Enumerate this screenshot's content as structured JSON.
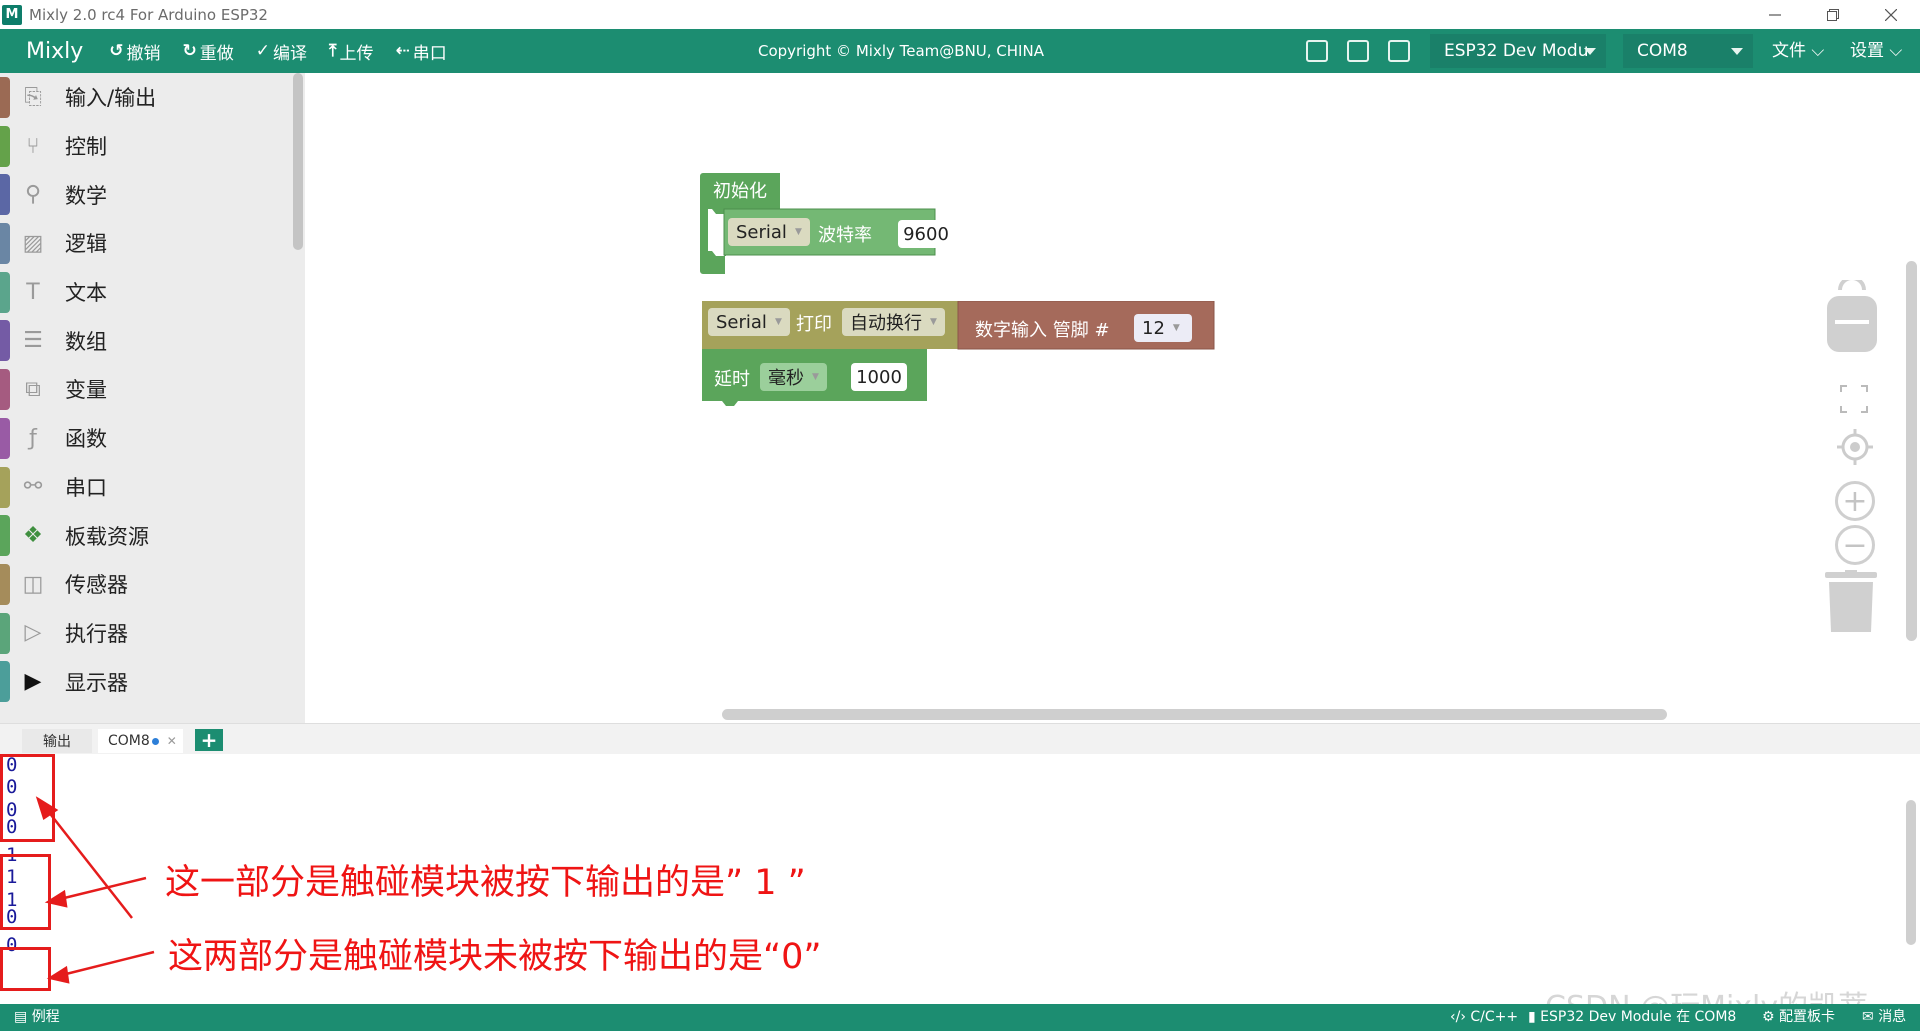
{
  "window": {
    "title": "Mixly 2.0 rc4 For Arduino ESP32",
    "icon_glyph": "M",
    "controls": [
      "minimize-icon",
      "restore-icon",
      "close-icon"
    ]
  },
  "toolbar": {
    "brand": "Mixly",
    "undo": "撤销",
    "redo": "重做",
    "compile": "编译",
    "upload": "上传",
    "serial": "串口",
    "copyright": "Copyright © Mixly Team@BNU, CHINA",
    "board": "ESP32 Dev Modu",
    "port": "COM8",
    "file_menu": "文件",
    "settings_menu": "设置",
    "accent_color": "#1c8d71"
  },
  "sidebar": {
    "categories": [
      {
        "label": "输入/输出",
        "icon": "io-icon",
        "color": "#9b6a54"
      },
      {
        "label": "控制",
        "icon": "branch-icon",
        "color": "#64a24a"
      },
      {
        "label": "数学",
        "icon": "math-icon",
        "color": "#5b67a5"
      },
      {
        "label": "逻辑",
        "icon": "logic-icon",
        "color": "#6a86a4"
      },
      {
        "label": "文本",
        "icon": "text-icon",
        "color": "#5ba58c"
      },
      {
        "label": "数组",
        "icon": "list-icon",
        "color": "#745ba5"
      },
      {
        "label": "变量",
        "icon": "variable-icon",
        "color": "#a55b80"
      },
      {
        "label": "函数",
        "icon": "function-icon",
        "color": "#995ba5"
      },
      {
        "label": "串口",
        "icon": "serial-icon",
        "color": "#a5a25b"
      },
      {
        "label": "板载资源",
        "icon": "board-icon",
        "color": "#5ba55b"
      },
      {
        "label": "传感器",
        "icon": "sensor-icon",
        "color": "#a58c5b"
      },
      {
        "label": "执行器",
        "icon": "actuator-icon",
        "color": "#5ba57a"
      },
      {
        "label": "显示器",
        "icon": "display-icon",
        "color": "#4c9e9a"
      }
    ]
  },
  "blocks": {
    "setup": {
      "label": "初始化",
      "serial": "Serial",
      "baud_label": "波特率",
      "baud": "9600"
    },
    "print": {
      "serial": "Serial",
      "print_label": "打印",
      "mode": "自动换行"
    },
    "digital_read": {
      "label": "数字输入 管脚 #",
      "pin": "12"
    },
    "delay": {
      "label": "延时",
      "unit": "毫秒",
      "value": "1000"
    }
  },
  "console": {
    "tab_output": "输出",
    "tab_port": "COM8",
    "lines": [
      "0",
      "0",
      "0",
      "0",
      "1",
      "1",
      "1",
      "0",
      "0"
    ],
    "annotation_1": "这一部分是触碰模块被按下输出的是” 1 ”",
    "annotation_2": "这两部分是触碰模块未被按下输出的是“0”",
    "watermark": "CSDN @玩Mixly的凯蒂"
  },
  "statusbar": {
    "examples": "例程",
    "language": "C/C++",
    "board_status": "ESP32 Dev Module 在 COM8",
    "config": "配置板卡",
    "messages": "消息"
  }
}
